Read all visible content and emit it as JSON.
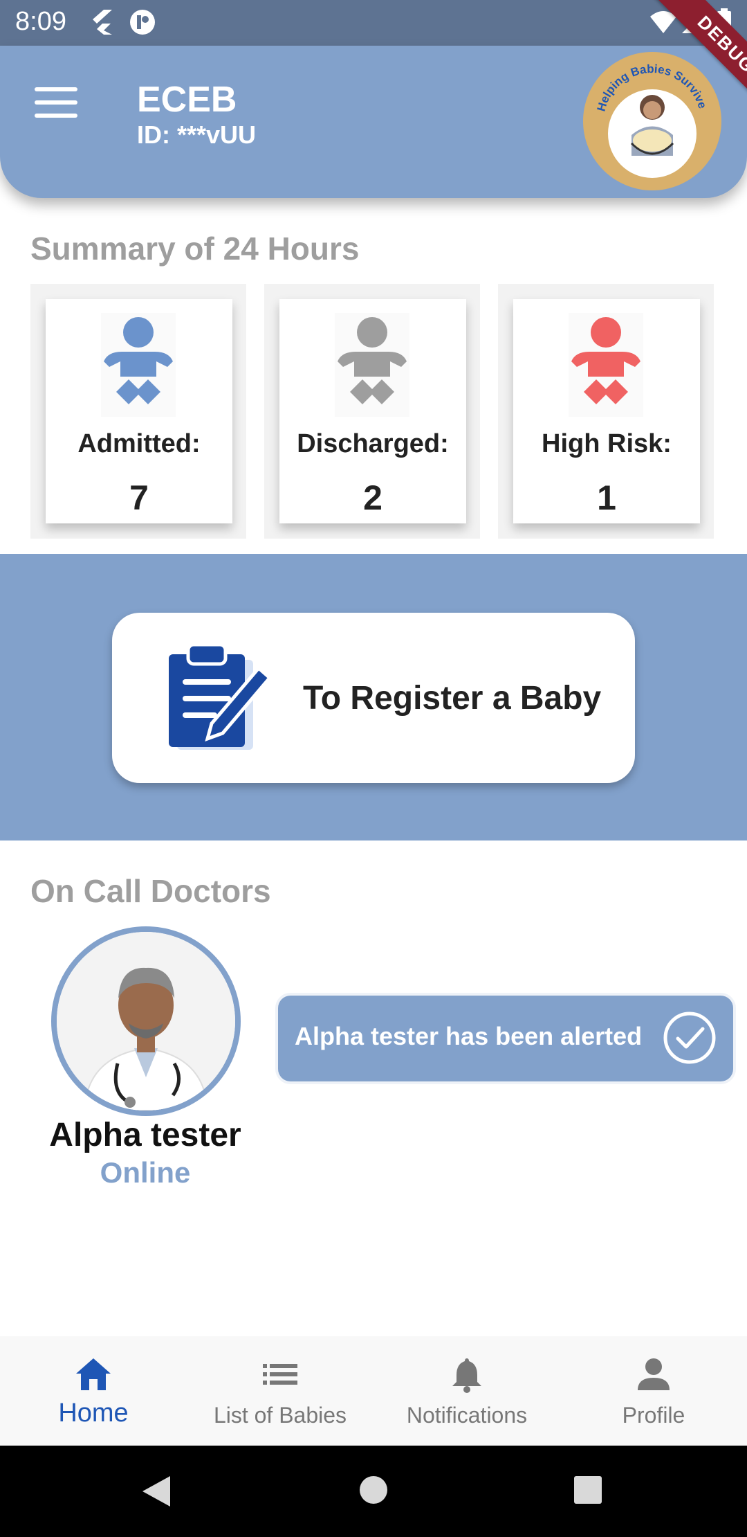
{
  "status_bar": {
    "time": "8:09"
  },
  "header": {
    "title": "ECEB",
    "user_id": "ID: ***vUU",
    "logo_text": "Helping Babies Survive",
    "debug_label": "DEBUG"
  },
  "summary": {
    "title": "Summary of 24 Hours",
    "cards": [
      {
        "label": "Admitted:",
        "count": "7",
        "color": "#6b93cc"
      },
      {
        "label": "Discharged:",
        "count": "2",
        "color": "#9e9e9e"
      },
      {
        "label": "High Risk:",
        "count": "1",
        "color": "#f06262"
      }
    ]
  },
  "register": {
    "label": "To Register a Baby"
  },
  "doctors": {
    "title": "On Call Doctors",
    "doctor": {
      "name": "Alpha tester",
      "status": "Online"
    },
    "alert": "Alpha tester has been alerted"
  },
  "bottom_nav": {
    "items": [
      {
        "label": "Home",
        "icon": "home-icon",
        "active": true
      },
      {
        "label": "List of Babies",
        "icon": "list-icon",
        "active": false
      },
      {
        "label": "Notifications",
        "icon": "bell-icon",
        "active": false
      },
      {
        "label": "Profile",
        "icon": "person-icon",
        "active": false
      }
    ]
  },
  "colors": {
    "accent": "#82a1cb",
    "status_bar": "#5e7392",
    "active_nav": "#1e56b5",
    "clipboard": "#1a48a0"
  }
}
